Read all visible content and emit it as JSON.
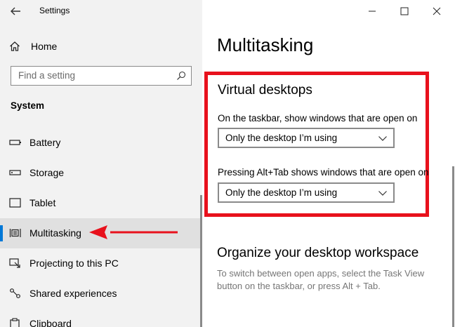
{
  "window": {
    "title": "Settings"
  },
  "sidebar": {
    "home_label": "Home",
    "search_placeholder": "Find a setting",
    "section_title": "System",
    "items": [
      {
        "label": "Battery",
        "icon": "battery-icon"
      },
      {
        "label": "Storage",
        "icon": "storage-icon"
      },
      {
        "label": "Tablet",
        "icon": "tablet-icon"
      },
      {
        "label": "Multitasking",
        "icon": "multitasking-icon",
        "active": true
      },
      {
        "label": "Projecting to this PC",
        "icon": "projecting-icon"
      },
      {
        "label": "Shared experiences",
        "icon": "shared-experiences-icon"
      },
      {
        "label": "Clipboard",
        "icon": "clipboard-icon"
      }
    ]
  },
  "main": {
    "page_title": "Multitasking",
    "virtual_desktops": {
      "title": "Virtual desktops",
      "taskbar_label": "On the taskbar, show windows that are open on",
      "taskbar_value": "Only the desktop I’m using",
      "alttab_label": "Pressing Alt+Tab shows windows that are open on",
      "alttab_value": "Only the desktop I’m using"
    },
    "organize": {
      "title": "Organize your desktop workspace",
      "description": "To switch between open apps, select the Task View button on the taskbar, or press Alt + Tab."
    }
  },
  "colors": {
    "accent": "#0078d7",
    "highlight_red": "#e8111c",
    "sidebar_bg": "#f2f2f2"
  }
}
